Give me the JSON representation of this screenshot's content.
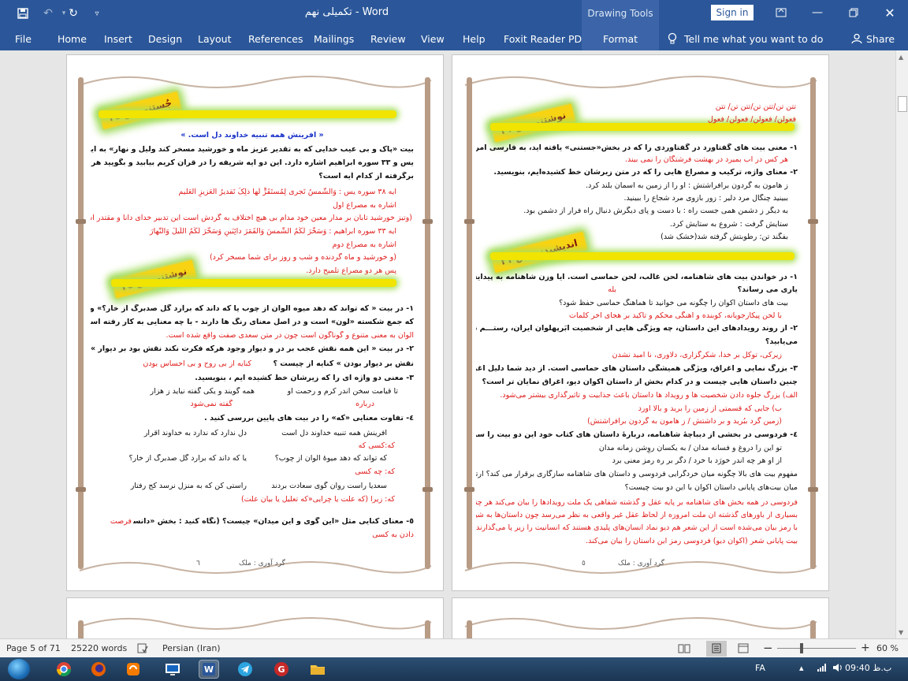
{
  "app": {
    "title": "تکمیلی نهم  -  Word",
    "drawing_tools": "Drawing Tools",
    "sign_in": "Sign in",
    "share": "Share",
    "tell_me": "Tell me what you want to do",
    "accent": "#2b579a"
  },
  "tabs": [
    "File",
    "Home",
    "Insert",
    "Design",
    "Layout",
    "References",
    "Mailings",
    "Review",
    "View",
    "Help",
    "Foxit Reader PDF",
    "Format"
  ],
  "right_page": {
    "badge1": "نوشتنی ص ٢١",
    "meter1": "تتن تن/تتن تن/تتن تن/ تتن",
    "meter2": "فعولن/ فعولن/ فعولن/ فعول",
    "q1": "١- معنی بیت های گفتاورد در گفتاوردی را که در بخش«جستنی» یافته اید، به فارسی امروزی بنویسید.",
    "q1_a": "هر کس در آب بمیرد در بهشت فرشتگان را نمی بیند.",
    "q2": "٢- معنای واژه، ترکیب و مصراع هایی را که در متن زیرشان خط کشیده‌ایم، بنویسید.",
    "q2_l1": "ز هامون به گردون برافراشتش : او را از زمین به آسمان بلند کرد.",
    "q2_l2": "ببینید چنگال مرد دلیر : زور بازوی مرد شجاع را ببینید.",
    "q2_l3": "به دیگر ز دشمن همی جست راه : با دست و پای دیگرش دنبال راه فرار از دشمن بود.",
    "q2_l4": "ستایش گرفت : شروع به ستایش کرد.",
    "q2_l5": "بفگند تن: رطوبتش گرفته شد(خشک شد)",
    "badge2": "اندیشیدنی ص ٢١",
    "a1": "١- در خواندن بیت های شاهنامه، لحن غالب، لحن حماسی است. آیا وزن شاهنامه به پیدایش این لحن",
    "a1b": "یاری می رساند؟",
    "a1_ans": "بله",
    "a1c": "بیت های داستان اکوان را چگونه می خوانید تا هماهنگ حماسی حفظ شود؟",
    "a1c_ans": "با لحن پیکارجویانه، کوبنده و آهنگی محکم و تاکید بر هجای آخر کلمات",
    "a2": "٢- از روند رویدادهای این داستان، چه ویژگی هایی از شخصیت ابَرپهلوان ایران، رستـــم دستـــان در",
    "a2b": "می‌یابید؟",
    "a2_ans": "زیرکی، توکل بر خدا، شکرگزاری، دلاوری، نا امید نشدن",
    "a3": "٣- بزرگ نمایی و اغراق، ویژگی همیشگی داستان های حماسی است. از دید شما دلیل اغراق آمیز بودن",
    "a3b": "چنین داستان هایی چیست و در کدام بخش از داستان اکوان دیو، اغراق نمایان تر است؟",
    "a3_ans1": "الف) بزرگ جلوه دادن شخصیت ها و رویداد ها داستان باعث جذابیت و تاثیرگذاری بیشتر می‌شود.",
    "a3_ans2": "ب) جایی که قسمتی از زمین را برید و بالا آورد",
    "a3_ans3": "(زمین گرد ببُرید و بر داشتش / ز هامون به گردون برافراشتش)",
    "a4": "٤- فردوسی در بخشی از دیباچهٔ شاهنامه، دربارهٔ داستان های کتاب خود این دو بیت را سروده است:",
    "a4_v1": "تو این را دروغ و فسانه مدان / به یکسان روِشن زمانه مدان",
    "a4_v2": "از او هر چه اندر خورَد با خرد / دگر بر ره رمز معنی برد",
    "a4_q": "مفهوم بیت های بالا چگونه میان خردگرایی فردوسی و داستان های شاهنامه سازگاری برقرار می کند؟ ارتباط",
    "a4_q2": "میان بیت‌های پایانی داستان اکوان با این دو بیت چیست؟",
    "a4_ans1": "فردوسی در همه بخش های شاهنامه بر پایه عقل و گذشته شفاهی یک ملت رویدادها را بیان می‌کند هر چند",
    "a4_ans2": "بسیاری از باورهای گذشته آن ملت امروزه از لحاظ عقل غیر واقعی به نظر می‌رسد چون داستان‌ها به شیوه نمادین و",
    "a4_ans3": "با رمز بیان می‌شده است از این شعر هم دیو نماد انسان‌های پلیدی هستند که انسانیت را زیر پا می‌گذارند در دو",
    "a4_ans4": "بیت پایانی شعر (اکوان دیو) فردوسی رمز این داستان را بیان می‌کند.",
    "footer_name": "گرد آوری : ملک",
    "footer_num": "٥"
  },
  "left_page": {
    "badge1": "جُستنی ص ٢٤",
    "title": "« آفرینش همه تنبیه خداوند دل است. »",
    "p1": "بیت «پاک و بی عیب خدایی که به تقدیر عزیز ماه و خورشید مسخر کند ولیل و نهار» به آیات ٣٨ سوره",
    "p2": "یس و ٣٣ سوره ابراهیم اشاره دارد.  این دو آیه شریفه را در قرآن کریم بیابید و بگویید هر بخش از بیت،",
    "p3": "برگرفته از کدام آیه است؟",
    "ay1": "آیه ٣٨ سوره یس : وَالشَّمسُ تَجری لِمُستَقَرٍّ لَها ذلِکَ تَقدیرُ العَزیزِ العَلیم",
    "ay1b": "اشاره به مصراع اول",
    "ay1c": "(وتیز خورشید تابان بر مدار معین خود مدام بی هیچ اختلاف به گردش است این تدبیر خدای دانا و مقتدر است)",
    "ay2": "آیه ٣٣ سوره ابراهیم : وَسَخَّرَ لَکُمُ الشَّمسَ وَالقَمَرَ دائِبَینِ وَسَخَّرَ لَکُمُ اللَّیلَ وَالنَّهارَ",
    "ay2b": "اشاره به مصراع دوم",
    "ay2c": "(و خورشید و ماه گردنده و شب و روز برای شما مسخر کرد)",
    "ay3": "پس هر دو مصراع تلمیح دارد.",
    "badge2": "نوشتنی ص ٢٤",
    "w1": "١- در بیت « که تواند که دهد میوه الوان از چوب یا که داند که برآرد گل صدبرگ از خار؟» واژه «الوان» –",
    "w1b": "که جمع شکسته «لون» است و در اصل معنای رنگ ها دارند - با چه معنایی به کار رفته است؟",
    "w1_ans": "الوان به معنی متنوع و گوناگون است چون در متن سعدی صفت واقع شده است.",
    "w2": "٢- در بیت « این همه نقش عجب بر در و دیوار وجود هرکه فکرت نکند نقش بود بر دیوار » ، عبارت«",
    "w2b": "نقش بر دیوار بودن » کنایه از چیست ؟",
    "w2_ans": "کنایه از بی روح و بی احساس بودن",
    "w3": "٣- معنی دو واژه ای را که زیرشان خط کشیده ایم ، بنویسید.",
    "w3_v1": "تا قیامت سخن اندر کرم و رحمت او",
    "w3_v2": "همه گویند و یکی گفته نیاید ز هزار",
    "w3_a1": "درباره",
    "w3_a2": "گفته نمی‌شود",
    "w4": "٤- تفاوت معنایی «که» را در بیت های پایین بررسی کنید .",
    "w4_l1a": "آفرینش همه تنبیه خداوند دل است",
    "w4_l1b": "دل ندارد که ندارد به خداوند اقرار",
    "w4_l1c": "که:کسی که",
    "w4_l2a": "که تواند که دهد میوهٔ الوان از چوب؟",
    "w4_l2b": "یا که داند که برآرد گل صدبرگ از خار؟",
    "w4_l2c": "که: چه کسی",
    "w4_l3a": "سعدیا راست روان گوی سعادت بردند",
    "w4_l3b": "راستی کن که به منزل نرسد کج رفتار",
    "w4_l3c": "که: زیرا (که علت یا چرایی«که تعلیل یا بیان علت)",
    "w5": "٥- معنای کنایی مثل «این گوی و این میدان» چیست؟  (نگاه کنید : بخش «دانستنی» همین درس) فرصت",
    "w5b": "دادن به کسی",
    "footer_name": "گرد آوری : ملک",
    "footer_num": "٦"
  },
  "status": {
    "page": "Page 5 of 71",
    "words": "25220 words",
    "lang": "Persian (Iran)",
    "zoom": "60 %"
  },
  "taskbar": {
    "lang": "FA",
    "time": "09:40 ب.ظ"
  }
}
